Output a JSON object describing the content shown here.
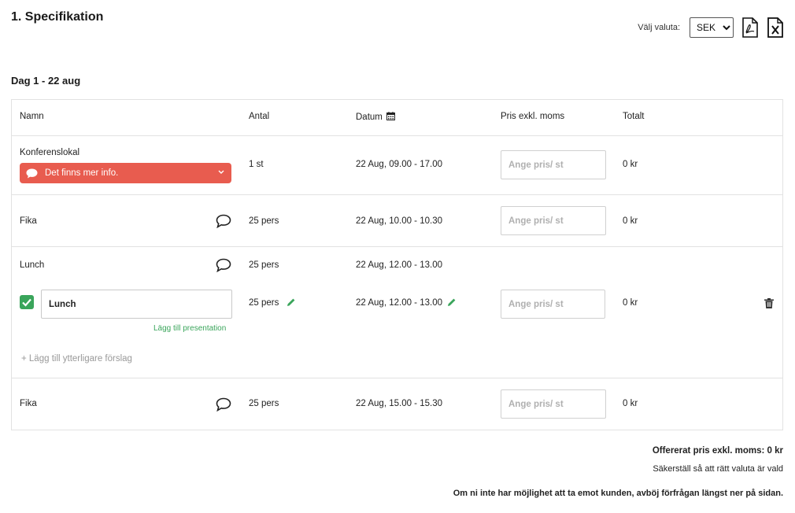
{
  "page": {
    "title": "1. Specifikation",
    "currency_label": "Välj valuta:",
    "currency_selected": "SEK",
    "pdf_icon": "pdf-file-icon",
    "excel_icon": "excel-file-icon"
  },
  "day": {
    "title": "Dag 1 - 22 aug"
  },
  "table": {
    "headers": {
      "name": "Namn",
      "quantity": "Antal",
      "date": "Datum",
      "price": "Pris exkl. moms",
      "total": "Totalt"
    },
    "price_placeholder": "Ange pris/ st",
    "rows": [
      {
        "name": "Konferenslokal",
        "quantity": "1 st",
        "date": "22 Aug, 09.00 - 17.00",
        "total": "0 kr",
        "info_label": "Det finns mer info."
      },
      {
        "name": "Fika",
        "quantity": "25 pers",
        "date": "22 Aug, 10.00 - 10.30",
        "total": "0 kr"
      },
      {
        "name": "Lunch",
        "quantity": "25 pers",
        "date": "22 Aug, 12.00 - 13.00",
        "suggestion": {
          "value": "Lunch",
          "quantity": "25 pers",
          "date": "22 Aug, 12.00 - 13.00",
          "total": "0 kr",
          "add_presentation": "Lägg till presentation"
        },
        "add_suggestion": "+ Lägg till ytterligare förslag"
      },
      {
        "name": "Fika",
        "quantity": "25 pers",
        "date": "22 Aug, 15.00 - 15.30",
        "total": "0 kr"
      }
    ]
  },
  "footer": {
    "offered_price": "Offererat pris exkl. moms: 0 kr",
    "ensure_currency": "Säkerställ så att rätt valuta är vald",
    "decline_note": "Om ni inte har möjlighet att ta emot kunden, avböj förfrågan längst ner på sidan."
  },
  "colors": {
    "accent_red": "#e85c4f",
    "accent_green": "#3aa55b",
    "border": "#e2e2e2"
  }
}
